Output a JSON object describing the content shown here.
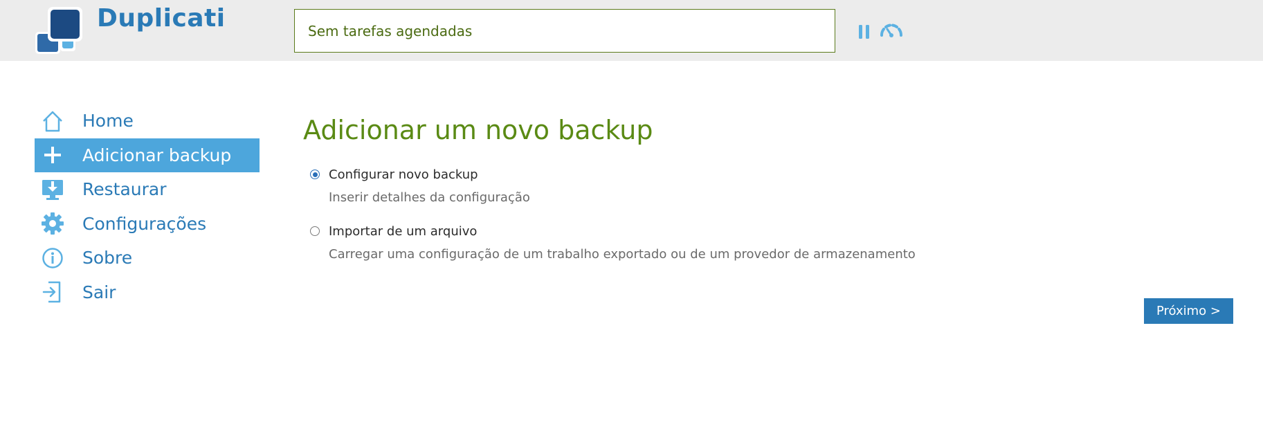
{
  "app": {
    "name": "Duplicati"
  },
  "header": {
    "status_text": "Sem tarefas agendadas",
    "pause_icon": "pause-icon",
    "throttle_icon": "speed-gauge-icon"
  },
  "sidebar": {
    "items": [
      {
        "label": "Home",
        "icon": "home-icon",
        "active": false
      },
      {
        "label": "Adicionar backup",
        "icon": "plus-icon",
        "active": true
      },
      {
        "label": "Restaurar",
        "icon": "restore-download-icon",
        "active": false
      },
      {
        "label": "Configurações",
        "icon": "gear-icon",
        "active": false
      },
      {
        "label": "Sobre",
        "icon": "info-icon",
        "active": false
      },
      {
        "label": "Sair",
        "icon": "logout-icon",
        "active": false
      }
    ]
  },
  "main": {
    "title": "Adicionar um novo backup",
    "options": [
      {
        "label": "Configurar novo backup",
        "description": "Inserir detalhes da configuração",
        "selected": true
      },
      {
        "label": "Importar de um arquivo",
        "description": "Carregar uma configuração de um trabalho exportado ou de um provedor de armazenamento",
        "selected": false
      }
    ],
    "next_label": "Próximo >"
  },
  "colors": {
    "brand_blue": "#2a7ab6",
    "active_nav": "#4da6dc",
    "title_green": "#5a8a14",
    "header_bg": "#ececec"
  }
}
